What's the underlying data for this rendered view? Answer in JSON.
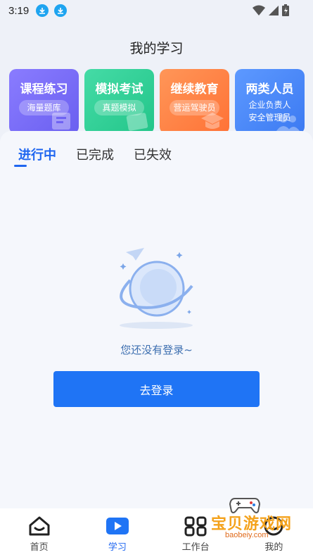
{
  "status_bar": {
    "time": "3:19"
  },
  "header": {
    "title": "我的学习"
  },
  "cards": [
    {
      "title": "课程练习",
      "subtitle": "海量题库",
      "color": "#7b6cf6"
    },
    {
      "title": "模拟考试",
      "subtitle": "真题模拟",
      "color": "#34d49a"
    },
    {
      "title": "继续教育",
      "subtitle": "营运驾驶员",
      "color": "#ff8748"
    },
    {
      "title": "两类人员",
      "subtitle_line1": "企业负责人",
      "subtitle_line2": "安全管理员",
      "color": "#4f8dff"
    }
  ],
  "tabs": [
    {
      "label": "进行中",
      "active": true
    },
    {
      "label": "已完成",
      "active": false
    },
    {
      "label": "已失效",
      "active": false
    }
  ],
  "empty_state": {
    "message": "您还没有登录~",
    "button_label": "去登录"
  },
  "bottom_nav": [
    {
      "label": "首页",
      "icon": "home-icon",
      "active": false
    },
    {
      "label": "学习",
      "icon": "play-icon",
      "active": true
    },
    {
      "label": "工作台",
      "icon": "workbench-icon",
      "active": false
    },
    {
      "label": "我的",
      "icon": "profile-icon",
      "active": false
    }
  ],
  "watermark": {
    "text": "宝贝游戏网",
    "url": "baobeiy.com"
  },
  "accent_color": "#1f66f0"
}
